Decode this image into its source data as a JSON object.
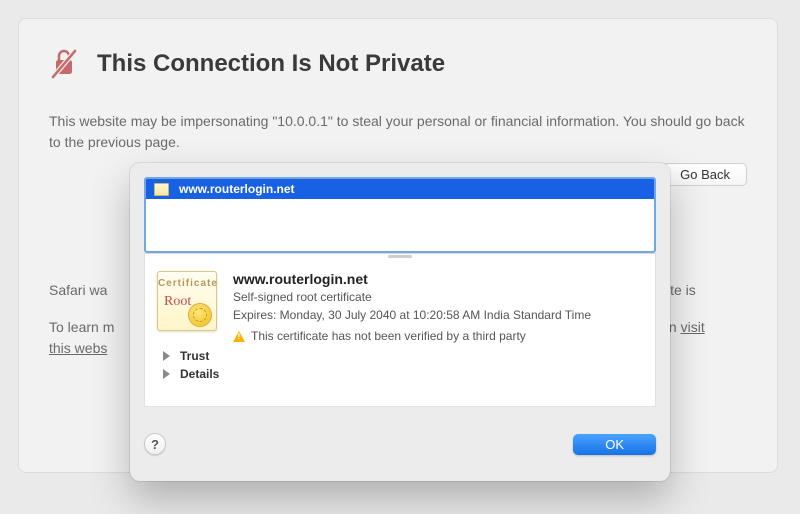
{
  "warning": {
    "title": "This Connection Is Not Private",
    "line1": "This website may be impersonating \"10.0.0.1\" to steal your personal or financial information. You should go back to the previous page.",
    "go_back_label": "Go Back",
    "safari_line_a": "Safari wa",
    "safari_line_b": "f the website is",
    "learn_line_a": "To learn m",
    "learn_line_b": "can ",
    "visit_link_a": "visit",
    "visit_link_b": "this webs"
  },
  "cert": {
    "list_item": "www.routerlogin.net",
    "title": "www.routerlogin.net",
    "subtitle": "Self-signed root certificate",
    "expires": "Expires: Monday, 30 July 2040 at 10:20:58 AM India Standard Time",
    "verify_warning": "This certificate has not been verified by a third party",
    "icon_word": "Certificate",
    "icon_root": "Root",
    "trust_label": "Trust",
    "details_label": "Details",
    "help_label": "?",
    "ok_label": "OK"
  }
}
